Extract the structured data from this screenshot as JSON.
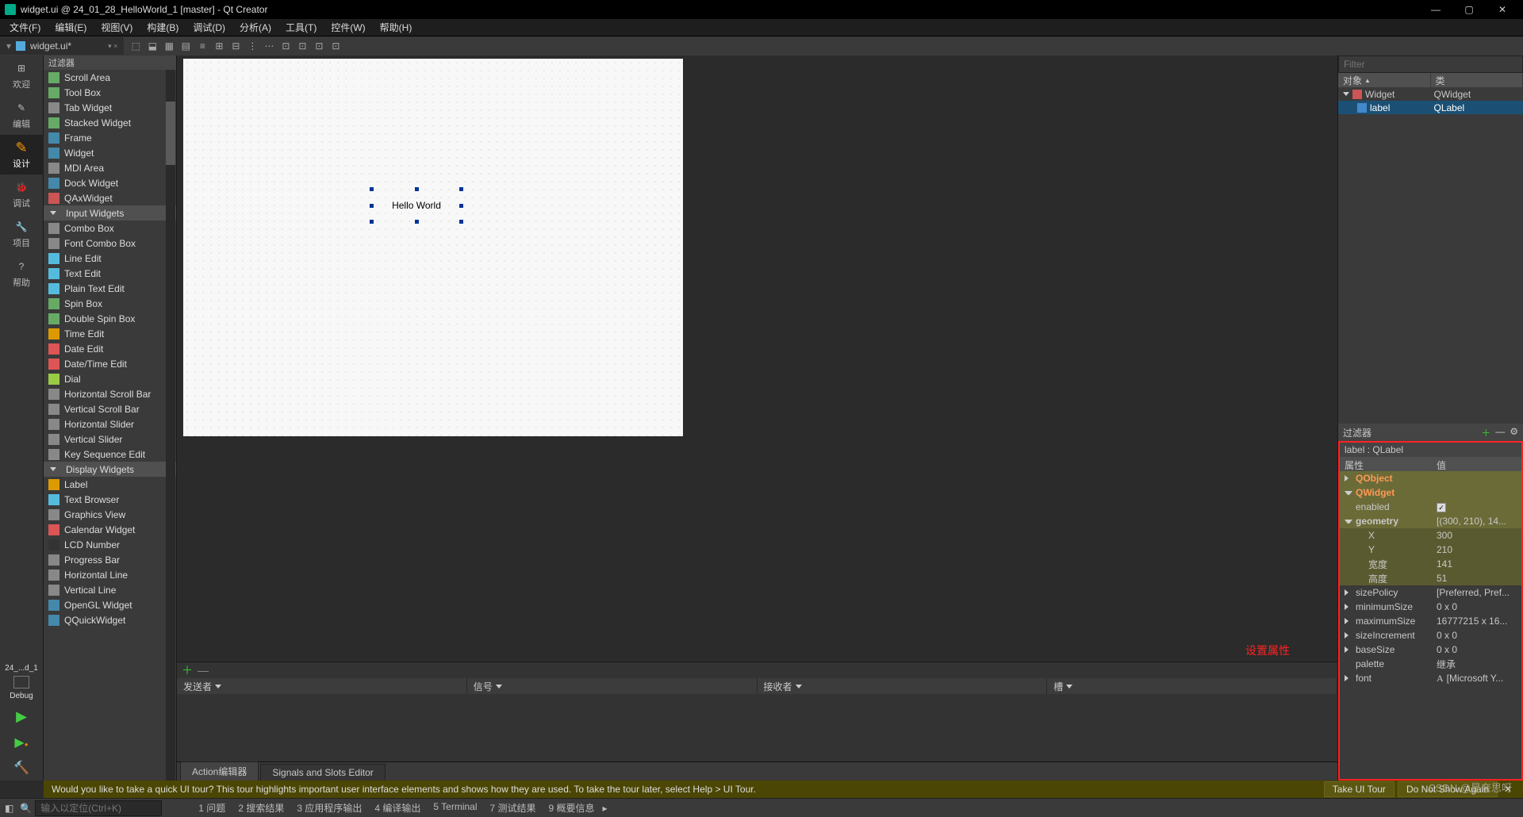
{
  "window": {
    "title": "widget.ui @ 24_01_28_HelloWorld_1 [master] - Qt Creator"
  },
  "menu": {
    "items": [
      "文件(F)",
      "编辑(E)",
      "视图(V)",
      "构建(B)",
      "调试(D)",
      "分析(A)",
      "工具(T)",
      "控件(W)",
      "帮助(H)"
    ]
  },
  "filetab": {
    "name": "widget.ui*",
    "close": "×"
  },
  "leftbar": {
    "items": [
      {
        "label": "欢迎",
        "icon": "grid"
      },
      {
        "label": "编辑",
        "icon": "edit"
      },
      {
        "label": "设计",
        "icon": "design",
        "active": true
      },
      {
        "label": "调试",
        "icon": "bug"
      },
      {
        "label": "项目",
        "icon": "wrench"
      },
      {
        "label": "帮助",
        "icon": "help"
      }
    ],
    "bottom": {
      "project": "24_...d_1",
      "mode": "Debug"
    }
  },
  "widgetbox": {
    "header": "过滤器",
    "items": [
      {
        "t": "Scroll Area",
        "i": "#6a6"
      },
      {
        "t": "Tool Box",
        "i": "#6a6"
      },
      {
        "t": "Tab Widget",
        "i": "#888"
      },
      {
        "t": "Stacked Widget",
        "i": "#6a6"
      },
      {
        "t": "Frame",
        "i": "#48a"
      },
      {
        "t": "Widget",
        "i": "#48a"
      },
      {
        "t": "MDI Area",
        "i": "#888"
      },
      {
        "t": "Dock Widget",
        "i": "#48a"
      },
      {
        "t": "QAxWidget",
        "i": "#c55"
      },
      {
        "t": "Input Widgets",
        "cat": true
      },
      {
        "t": "Combo Box",
        "i": "#888"
      },
      {
        "t": "Font Combo Box",
        "i": "#888"
      },
      {
        "t": "Line Edit",
        "i": "#5bd"
      },
      {
        "t": "Text Edit",
        "i": "#5bd"
      },
      {
        "t": "Plain Text Edit",
        "i": "#5bd"
      },
      {
        "t": "Spin Box",
        "i": "#6a6"
      },
      {
        "t": "Double Spin Box",
        "i": "#6a6"
      },
      {
        "t": "Time Edit",
        "i": "#d90"
      },
      {
        "t": "Date Edit",
        "i": "#d55"
      },
      {
        "t": "Date/Time Edit",
        "i": "#d55"
      },
      {
        "t": "Dial",
        "i": "#9c4"
      },
      {
        "t": "Horizontal Scroll Bar",
        "i": "#888"
      },
      {
        "t": "Vertical Scroll Bar",
        "i": "#888"
      },
      {
        "t": "Horizontal Slider",
        "i": "#888"
      },
      {
        "t": "Vertical Slider",
        "i": "#888"
      },
      {
        "t": "Key Sequence Edit",
        "i": "#888"
      },
      {
        "t": "Display Widgets",
        "cat": true
      },
      {
        "t": "Label",
        "i": "#d90"
      },
      {
        "t": "Text Browser",
        "i": "#5bd"
      },
      {
        "t": "Graphics View",
        "i": "#888"
      },
      {
        "t": "Calendar Widget",
        "i": "#d55"
      },
      {
        "t": "LCD Number",
        "i": "#333"
      },
      {
        "t": "Progress Bar",
        "i": "#888"
      },
      {
        "t": "Horizontal Line",
        "i": "#888"
      },
      {
        "t": "Vertical Line",
        "i": "#888"
      },
      {
        "t": "OpenGL Widget",
        "i": "#48a"
      },
      {
        "t": "QQuickWidget",
        "i": "#48a"
      }
    ]
  },
  "canvas": {
    "label_text": "Hello World",
    "attr_label": "设置属性"
  },
  "signals": {
    "cols": [
      "发送者",
      "信号",
      "接收者",
      "槽"
    ],
    "tabs": [
      "Action编辑器",
      "Signals and Slots Editor"
    ]
  },
  "objtree": {
    "filter_ph": "Filter",
    "cols": [
      "对象",
      "类"
    ],
    "rows": [
      {
        "obj": "Widget",
        "cls": "QWidget",
        "depth": 0
      },
      {
        "obj": "label",
        "cls": "QLabel",
        "depth": 1,
        "sel": true
      }
    ]
  },
  "props": {
    "filter": "过滤器",
    "title": "label : QLabel",
    "cols": [
      "属性",
      "值"
    ],
    "rows": [
      {
        "n": "QObject",
        "cat": true
      },
      {
        "n": "QWidget",
        "cat": true,
        "exp": true
      },
      {
        "n": "enabled",
        "v": "check",
        "sel": true
      },
      {
        "n": "geometry",
        "v": "[(300, 210), 14...",
        "sel": true,
        "exp": true,
        "bold": true
      },
      {
        "n": "X",
        "v": "300",
        "sub": true
      },
      {
        "n": "Y",
        "v": "210",
        "sub": true
      },
      {
        "n": "宽度",
        "v": "141",
        "sub": true
      },
      {
        "n": "高度",
        "v": "51",
        "sub": true
      },
      {
        "n": "sizePolicy",
        "v": "[Preferred, Pref...",
        "expR": true
      },
      {
        "n": "minimumSize",
        "v": "0 x 0",
        "expR": true
      },
      {
        "n": "maximumSize",
        "v": "16777215 x 16...",
        "expR": true
      },
      {
        "n": "sizeIncrement",
        "v": "0 x 0",
        "expR": true
      },
      {
        "n": "baseSize",
        "v": "0 x 0",
        "expR": true
      },
      {
        "n": "palette",
        "v": "继承"
      },
      {
        "n": "font",
        "v": "[Microsoft Y...",
        "expR": true,
        "icon": "A"
      }
    ]
  },
  "infobar": {
    "text": "Would you like to take a quick UI tour? This tour highlights important user interface elements and shows how they are used. To take the tour later, select Help > UI Tour.",
    "btn1": "Take UI Tour",
    "btn2": "Do Not Show Again"
  },
  "status": {
    "search_ph": "输入以定位(Ctrl+K)",
    "panes": [
      "1 问题",
      "2 搜索结果",
      "3 应用程序输出",
      "4 编译输出",
      "5 Terminal",
      "7 测试结果",
      "9 概要信息"
    ]
  },
  "watermark": "CSDN @是奈思呀"
}
